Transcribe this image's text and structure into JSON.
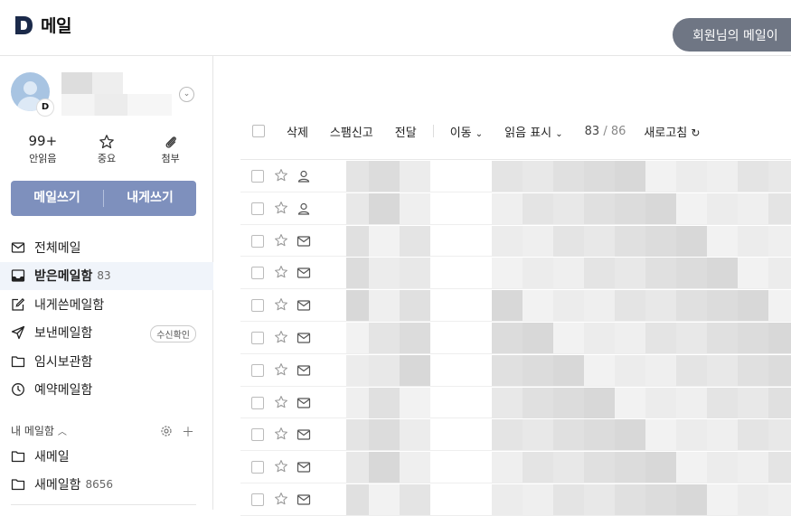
{
  "header": {
    "logo_letter": "D",
    "app_title": "메일",
    "promo_text": "회원님의 메일이 ",
    "promo_color": "#6f7684"
  },
  "profile": {
    "badge": "D"
  },
  "stats": [
    {
      "value": "99+",
      "label": "안읽음"
    },
    {
      "icon": "star-icon",
      "label": "중요"
    },
    {
      "icon": "paperclip-icon",
      "label": "첨부"
    }
  ],
  "compose": {
    "write_label": "메일쓰기",
    "self_label": "내게쓰기",
    "color": "#7e90bd"
  },
  "folders": [
    {
      "icon": "mail-icon",
      "label": "전체메일",
      "count": ""
    },
    {
      "icon": "inbox-icon",
      "label": "받은메일함",
      "count": "83",
      "active": true
    },
    {
      "icon": "edit-icon",
      "label": "내게쓴메일함",
      "count": ""
    },
    {
      "icon": "send-icon",
      "label": "보낸메일함",
      "count": "",
      "tag": "수신확인"
    },
    {
      "icon": "folder-icon",
      "label": "임시보관함",
      "count": ""
    },
    {
      "icon": "clock-icon",
      "label": "예약메일함",
      "count": ""
    }
  ],
  "my_folders": {
    "title": "내 메일함",
    "items": [
      {
        "icon": "folder-icon",
        "label": "새메일",
        "count": ""
      },
      {
        "icon": "folder-icon",
        "label": "새메일함",
        "count": "8656"
      }
    ]
  },
  "toolbar": {
    "delete": "삭제",
    "spam": "스팸신고",
    "forward": "전달",
    "move": "이동",
    "mark_read": "읽음 표시",
    "page_current": "83",
    "page_total": "/ 86",
    "refresh": "새로고침"
  },
  "rows": [
    {
      "kind": "person-icon"
    },
    {
      "kind": "person-icon"
    },
    {
      "kind": "envelope-icon"
    },
    {
      "kind": "envelope-icon"
    },
    {
      "kind": "envelope-icon"
    },
    {
      "kind": "envelope-icon"
    },
    {
      "kind": "envelope-icon"
    },
    {
      "kind": "envelope-icon"
    },
    {
      "kind": "envelope-icon"
    },
    {
      "kind": "envelope-icon"
    },
    {
      "kind": "envelope-icon"
    }
  ]
}
